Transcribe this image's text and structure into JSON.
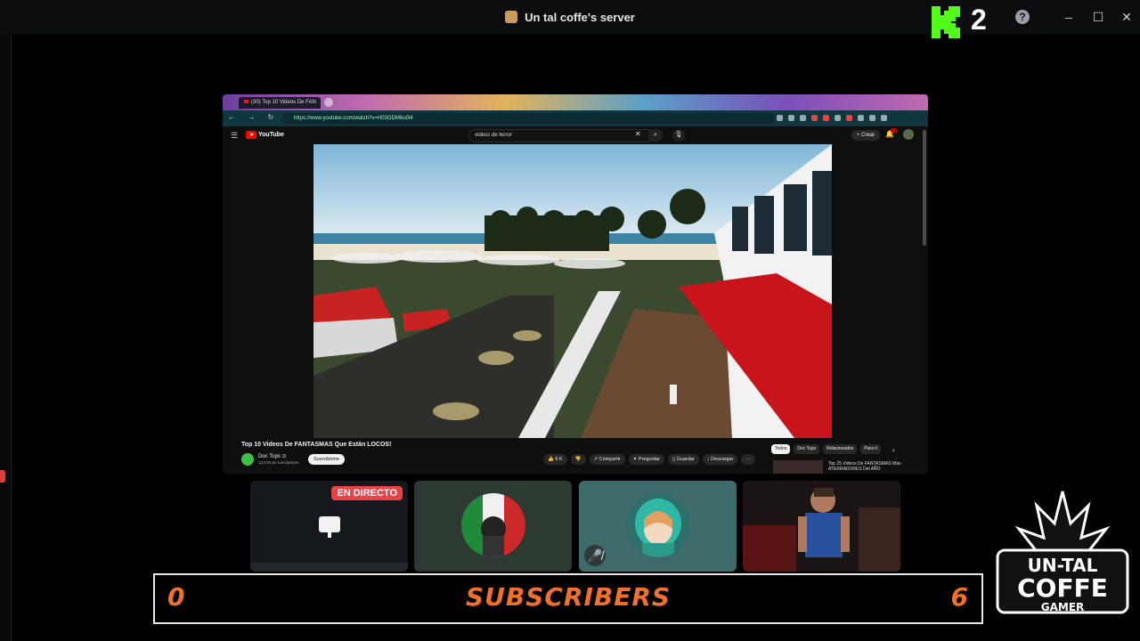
{
  "window": {
    "title": "Un tal coffe's server",
    "controls": [
      "–",
      "☐",
      "✕"
    ]
  },
  "kick": {
    "count": "2",
    "help_label": "?"
  },
  "browser": {
    "tab_title": "(30) Top 10 Videos De FAN",
    "url": "https://www.youtube.com/watch?v=H03ODM6ul34",
    "nav_icons": "← → ↻ ⌂"
  },
  "youtube": {
    "logo_text": "YouTube",
    "search_value": "videos de terror",
    "create_label": "+ Crear",
    "video_title": "Top 10 Videos De FANTASMAS Que Están LOCOS!",
    "channel_name": "Doc Tops ⊙",
    "channel_subs": "12,6 M de suscriptores",
    "subscribe_label": "Suscribirme",
    "actions": [
      "👍 6 K",
      "👎",
      "↗ Compartir",
      "✦ Preguntar",
      "▯ Guardar",
      "↓ Descargar",
      "···"
    ],
    "chips": [
      "Todos",
      "Doc Tops",
      "Relacionados",
      "Para ti"
    ],
    "recommended_title": "Top 25 Videos De FANTASMAS Más ATERRADORES Del AÑO"
  },
  "tiles": {
    "live_label": "EN DIRECTO",
    "mute_label": "🎤̸"
  },
  "subscribers": {
    "left": "0",
    "label": "SUBSCRIBERS",
    "right": "6"
  },
  "logo": {
    "line1": "UN-TAL",
    "line2": "COFFE",
    "line3": "GAMER"
  },
  "colors": {
    "accent_orange": "#f2702a",
    "live_red": "#ed4245",
    "kick_green": "#53fc18",
    "yt_red": "#ff0000"
  }
}
